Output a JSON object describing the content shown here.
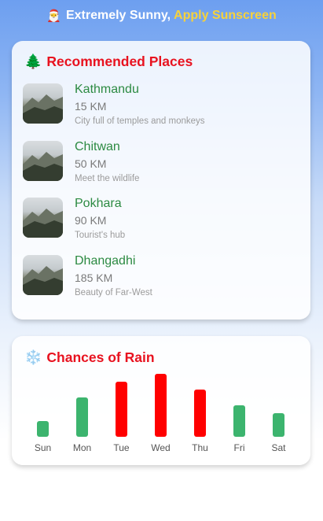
{
  "banner": {
    "emoji": "🎅",
    "text": "Extremely Sunny,",
    "accent_text": "Apply Sunscreen",
    "accent_color": "#f7d23a"
  },
  "places_card": {
    "icon": "tree-icon",
    "icon_glyph": "🌲",
    "title": "Recommended Places",
    "items": [
      {
        "name": "Kathmandu",
        "distance": "15 KM",
        "description": "City full of temples and monkeys"
      },
      {
        "name": "Chitwan",
        "distance": "50 KM",
        "description": "Meet the wildlife"
      },
      {
        "name": "Pokhara",
        "distance": "90 KM",
        "description": "Tourist's hub"
      },
      {
        "name": "Dhangadhi",
        "distance": "185 KM",
        "description": "Beauty of Far-West"
      }
    ]
  },
  "rain_card": {
    "icon": "snowflake-icon",
    "icon_glyph": "❄️",
    "title": "Chances of Rain"
  },
  "colors": {
    "title_red": "#e8121f",
    "place_green": "#2c8a42",
    "bar_green": "#3cb46e",
    "bar_red": "#ff0000"
  },
  "chart_data": {
    "type": "bar",
    "categories": [
      "Sun",
      "Mon",
      "Tue",
      "Wed",
      "Thu",
      "Fri",
      "Sat"
    ],
    "values": [
      2,
      5,
      7,
      8,
      6,
      4,
      3
    ],
    "highlight": [
      "low",
      "low",
      "high",
      "high",
      "high",
      "low",
      "low"
    ],
    "title": "",
    "xlabel": "",
    "ylabel": "",
    "ylim": [
      0,
      8
    ]
  }
}
